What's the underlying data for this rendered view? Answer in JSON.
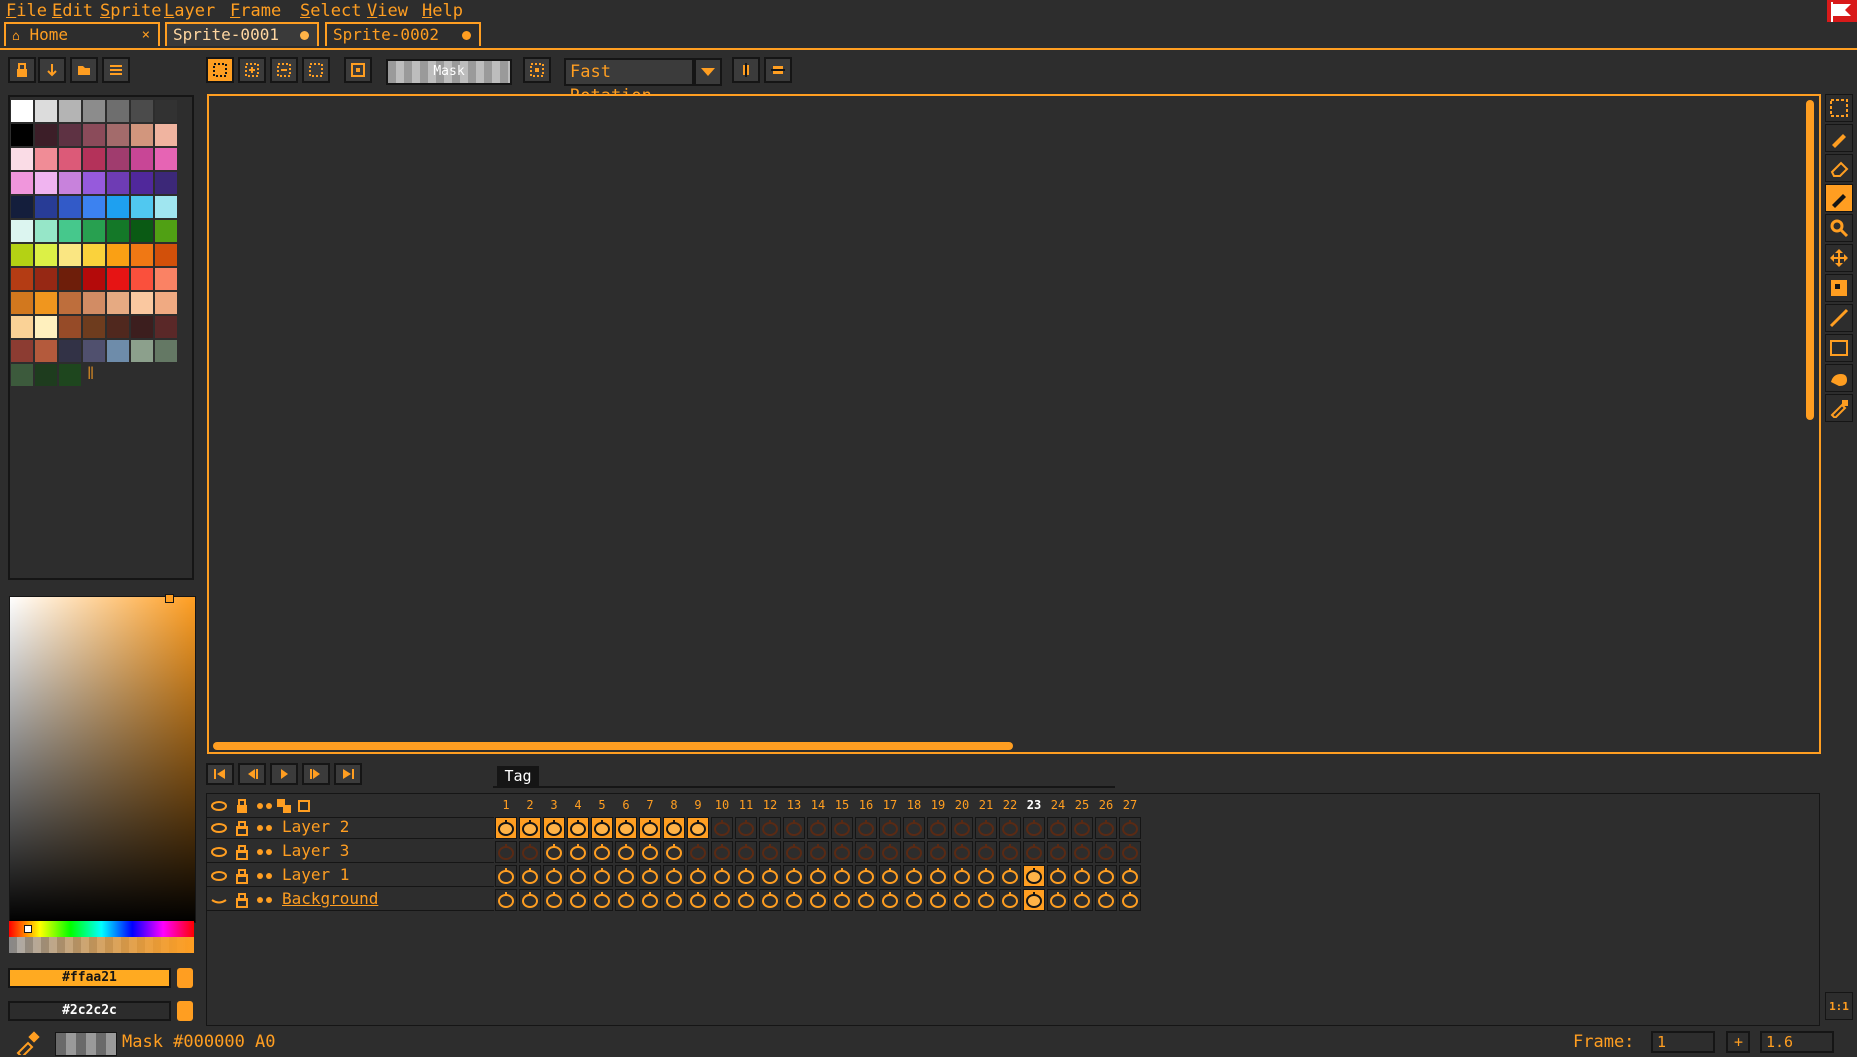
{
  "menu": {
    "items": [
      {
        "label": "File",
        "ul": "F",
        "rest": "ile"
      },
      {
        "label": "Edit",
        "ul": "E",
        "rest": "dit"
      },
      {
        "label": "Sprite",
        "ul": "S",
        "rest": "prite"
      },
      {
        "label": "Layer",
        "ul": "L",
        "rest": "ayer"
      },
      {
        "label": "Frame",
        "ul": "F",
        "rest": "rame"
      },
      {
        "label": "Select",
        "ul": "S",
        "rest": "elect"
      },
      {
        "label": "View",
        "ul": "V",
        "rest": "iew"
      },
      {
        "label": "Help",
        "ul": "H",
        "rest": "elp"
      }
    ]
  },
  "tabs": [
    {
      "label": "Home",
      "close": "×",
      "icon": "home-icon"
    },
    {
      "label": "Sprite-0001",
      "active": true
    },
    {
      "label": "Sprite-0002"
    }
  ],
  "toolbar": {
    "mask_label": "Mask",
    "rotation_value": "Fast Rotation"
  },
  "palette": {
    "colors": [
      "#ffffff",
      "#dcdcdc",
      "#b4b4b4",
      "#8c8c8c",
      "#6e6e6e",
      "#4b4b4b",
      "#323232",
      "#000000",
      "#3c1e28",
      "#5e3243",
      "#8b4b5a",
      "#a36b6b",
      "#d2967d",
      "#f0b4a0",
      "#fadce6",
      "#f08c96",
      "#dc5a78",
      "#b4325a",
      "#a03c6e",
      "#c84696",
      "#e664b4",
      "#f096dc",
      "#f0b4f0",
      "#c882dc",
      "#965adc",
      "#6e3cb4",
      "#50289b",
      "#3c2878",
      "#141e3c",
      "#283c96",
      "#325ac8",
      "#3c82f0",
      "#1ea0f0",
      "#50c8f0",
      "#a0e6f0",
      "#dcf5f0",
      "#96e6c8",
      "#46c88c",
      "#28a050",
      "#147828",
      "#0a5a14",
      "#50a014",
      "#b4d214",
      "#dcf046",
      "#fae682",
      "#fad23c",
      "#faa014",
      "#f07814",
      "#d2500a",
      "#b43c14",
      "#962814",
      "#6e1e0a",
      "#b40a0a",
      "#e61414",
      "#fa503c",
      "#fa8264",
      "#d2781e",
      "#f0961e",
      "#be6e3c",
      "#d28c64",
      "#e6aa82",
      "#fac8a0",
      "#f0aa82",
      "#fad296",
      "#fff0be",
      "#964b28",
      "#6e3c1e",
      "#50281e",
      "#3c1e1e",
      "#5a2828",
      "#8c3c32",
      "#b45a3c",
      "#323246",
      "#50506e",
      "#6e8caa",
      "#8ca08c",
      "#647864",
      "#3c5a3c",
      "#1e3c1e",
      "#1e461e"
    ],
    "more_indicator": "‖"
  },
  "colors": {
    "foreground": "#ffaa21",
    "background": "#2c2c2c",
    "accent": "#ff9e21",
    "bg": "#2d2d2d"
  },
  "timeline": {
    "tag_label": "Tag",
    "frames": [
      "1",
      "2",
      "3",
      "4",
      "5",
      "6",
      "7",
      "8",
      "9",
      "10",
      "11",
      "12",
      "13",
      "14",
      "15",
      "16",
      "17",
      "18",
      "19",
      "20",
      "21",
      "22",
      "23",
      "24",
      "25",
      "26",
      "27"
    ],
    "active_frame": 23,
    "layers": [
      {
        "name": "Layer 2",
        "cels": "filled",
        "filled_frames": [
          1,
          2,
          3,
          4,
          5,
          6,
          7,
          8,
          9
        ]
      },
      {
        "name": "Layer 3",
        "cels": "partial",
        "filled_frames": [
          3,
          4,
          5,
          6,
          7,
          8
        ]
      },
      {
        "name": "Layer 1",
        "cels": "all"
      },
      {
        "name": "Background",
        "cels": "all",
        "selected": true
      }
    ]
  },
  "status": {
    "text": "Mask #000000 A0",
    "frame_label": "Frame:",
    "frame_value": "1",
    "plus": "+",
    "zoom_value": "1.6"
  },
  "right_tools": [
    "marquee-icon",
    "pencil-icon",
    "eraser-icon",
    "spray-icon",
    "zoom-icon",
    "move-icon",
    "slice-icon",
    "line-icon",
    "rectangle-icon",
    "fill-icon",
    "eyedropper-icon"
  ],
  "zoom_reset_label": "1:1"
}
